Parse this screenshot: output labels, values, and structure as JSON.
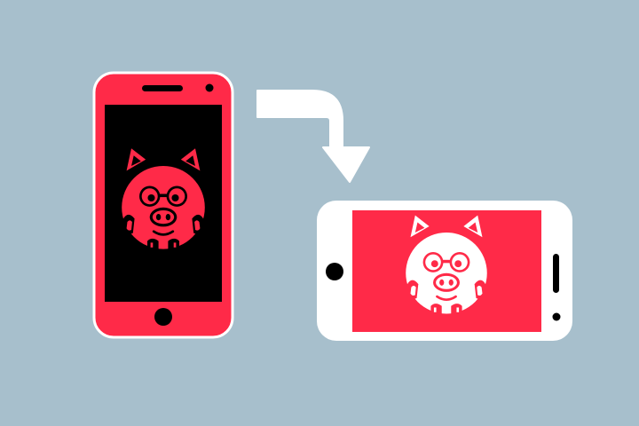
{
  "colors": {
    "background": "#A7BFCC",
    "accent": "#FF2A48",
    "screen_dark": "#000000",
    "light": "#FFFFFF",
    "outline": "#FFFFFF"
  },
  "illustration": {
    "portrait_phone": {
      "screen_theme": "dark",
      "icon": "pig-icon",
      "orientation": "portrait"
    },
    "arrow": {
      "icon": "rotate-arrow-icon",
      "direction": "right-then-down"
    },
    "landscape_phone": {
      "screen_theme": "accent",
      "icon": "pig-icon",
      "orientation": "landscape"
    }
  }
}
